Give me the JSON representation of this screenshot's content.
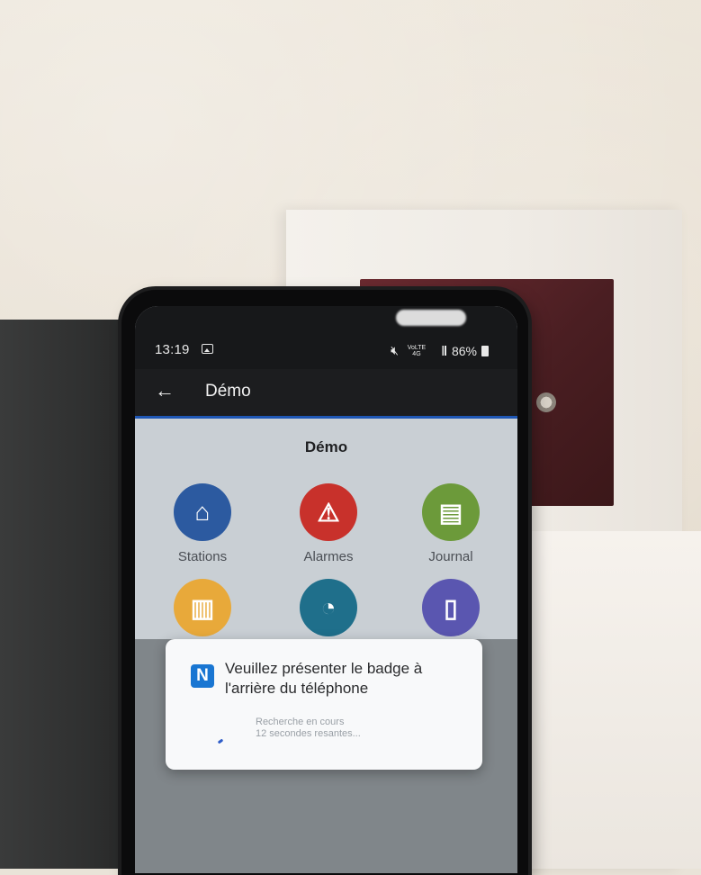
{
  "status_bar": {
    "time": "13:19",
    "network_top": "VoLTE 4G",
    "battery": "86%"
  },
  "app_bar": {
    "back_icon": "arrow-left-icon",
    "title": "Démo"
  },
  "main": {
    "title": "Démo",
    "tiles": [
      {
        "label": "Stations",
        "icon": "home-icon",
        "color": "#2c5aa0"
      },
      {
        "label": "Alarmes",
        "icon": "warning-icon",
        "color": "#c8312b"
      },
      {
        "label": "Journal",
        "icon": "document-icon",
        "color": "#6c9a3a"
      },
      {
        "label": "",
        "icon": "bar-chart-icon",
        "color": "#e8a93a"
      },
      {
        "label": "",
        "icon": "magnifier-chart-icon",
        "color": "#1f6f8b"
      },
      {
        "label": "",
        "icon": "mobile-phone-icon",
        "color": "#5a56b0"
      }
    ]
  },
  "nfc_dialog": {
    "icon": "nfc-icon",
    "message": "Veuillez présenter le badge à l'arrière du téléphone",
    "status_line1": "Recherche en cours",
    "status_line2": "12 secondes resantes..."
  }
}
